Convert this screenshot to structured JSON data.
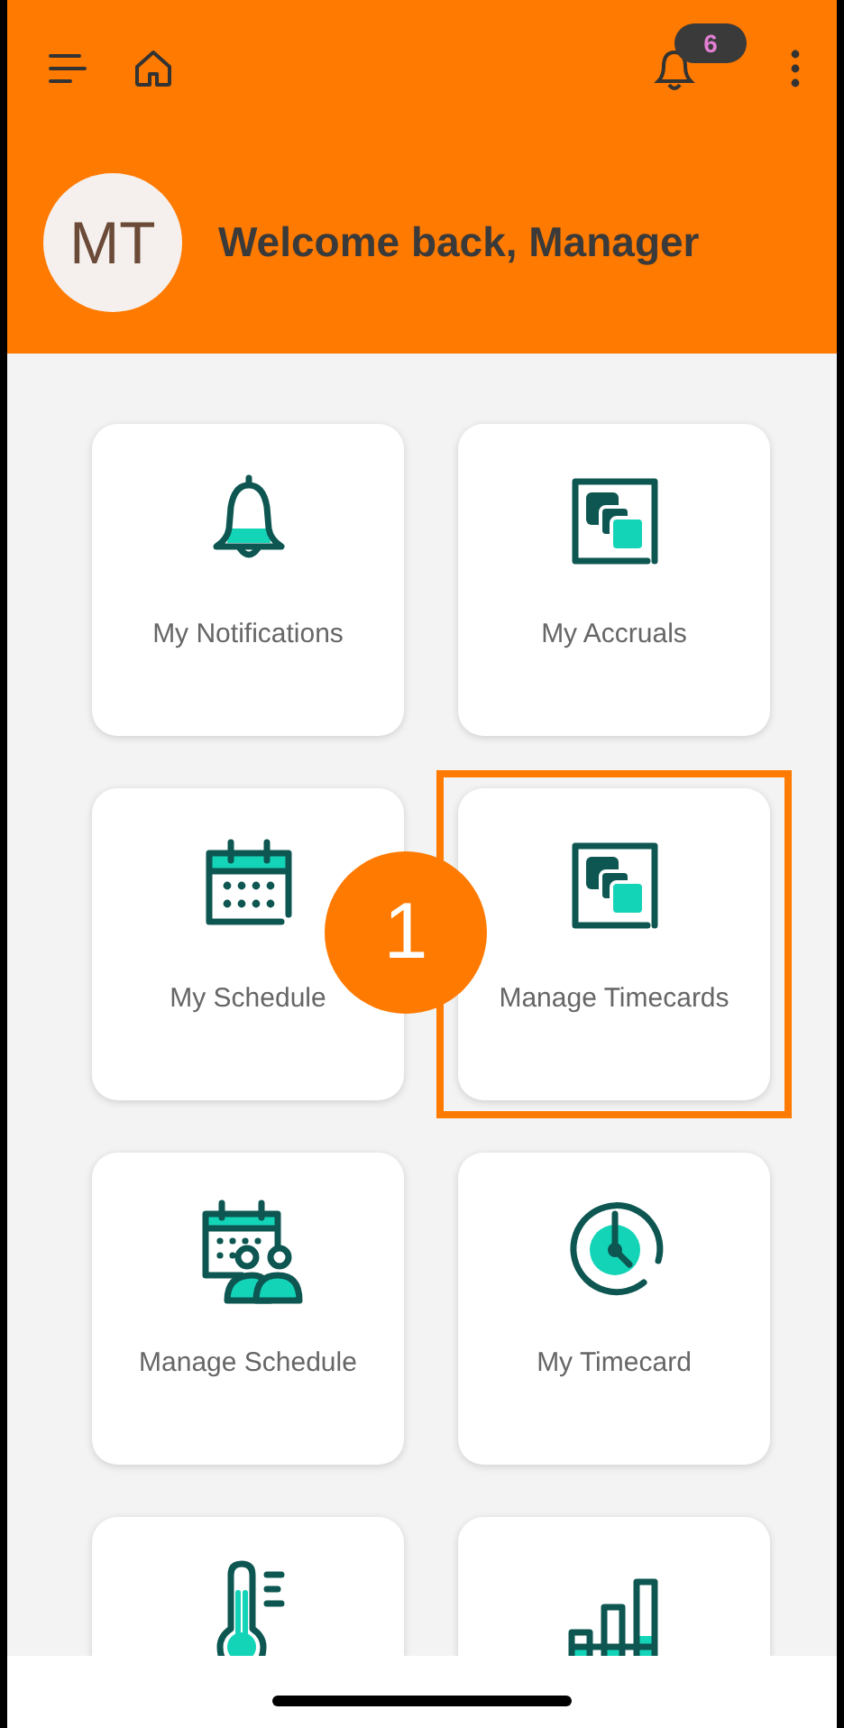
{
  "header": {
    "notification_count": "6",
    "avatar_initials": "MT",
    "welcome": "Welcome back, Manager"
  },
  "tiles": [
    {
      "kind": "bell",
      "label": "My Notifications"
    },
    {
      "kind": "accruals",
      "label": "My Accruals"
    },
    {
      "kind": "calendar",
      "label": "My Schedule"
    },
    {
      "kind": "accruals",
      "label": "Manage Timecards",
      "highlighted": true,
      "callout": "1"
    },
    {
      "kind": "team-calendar",
      "label": "Manage Schedule"
    },
    {
      "kind": "clock",
      "label": "My Timecard"
    },
    {
      "kind": "thermometer"
    },
    {
      "kind": "chart"
    }
  ]
}
